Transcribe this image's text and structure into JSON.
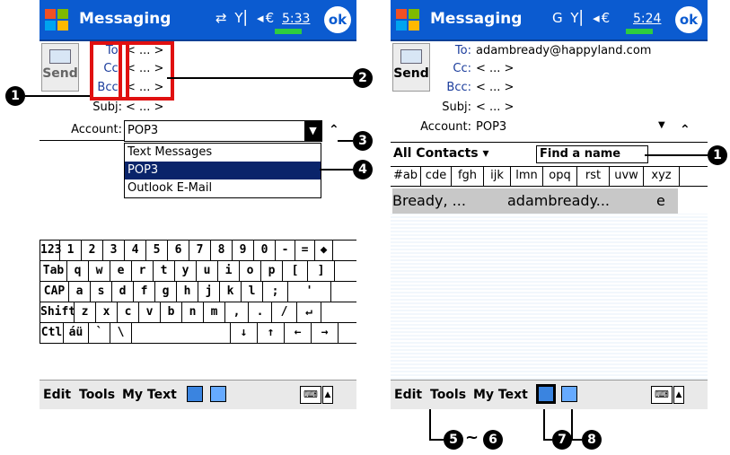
{
  "left_screen": {
    "title": "Messaging",
    "signal_icons": "⇄ Y▏◂€",
    "time": "5:33",
    "ok_label": "ok",
    "send_label": "Send",
    "header_labels": [
      "To:",
      "Cc:",
      "Bcc:",
      "Subj:"
    ],
    "header_values": [
      "< ... >",
      "< ... >",
      "< ... >",
      "< ... >"
    ],
    "account_label": "Account:",
    "account_value": "POP3",
    "account_options": [
      "Text Messages",
      "POP3",
      "Outlook E-Mail"
    ],
    "selected_option": "POP3",
    "keyboard_rows": [
      [
        "123",
        "1",
        "2",
        "3",
        "4",
        "5",
        "6",
        "7",
        "8",
        "9",
        "0",
        "-",
        "=",
        "◆"
      ],
      [
        "Tab",
        "q",
        "w",
        "e",
        "r",
        "t",
        "y",
        "u",
        "i",
        "o",
        "p",
        "[",
        "]"
      ],
      [
        "CAP",
        "a",
        "s",
        "d",
        "f",
        "g",
        "h",
        "j",
        "k",
        "l",
        ";",
        "'"
      ],
      [
        "Shift",
        "z",
        "x",
        "c",
        "v",
        "b",
        "n",
        "m",
        ",",
        ".",
        "/",
        "↵"
      ],
      [
        "Ctl",
        "áü",
        "`",
        "\\",
        "",
        "↓",
        "↑",
        "←",
        "→"
      ]
    ],
    "menu": [
      "Edit",
      "Tools",
      "My Text"
    ]
  },
  "right_screen": {
    "title": "Messaging",
    "signal_icons": "G Y▏◂€",
    "time": "5:24",
    "ok_label": "ok",
    "send_label": "Send",
    "header_labels": [
      "To:",
      "Cc:",
      "Bcc:",
      "Subj:",
      "Account:"
    ],
    "header_values": [
      "adambready@happyland.com",
      "< ... >",
      "< ... >",
      "< ... >",
      "POP3"
    ],
    "contacts_filter": "All Contacts",
    "find_placeholder": "Find a name",
    "abc_tabs": [
      "#ab",
      "cde",
      "fgh",
      "ijk",
      "lmn",
      "opq",
      "rst",
      "uvw",
      "xyz"
    ],
    "contact_name": "Bready, ...",
    "contact_email": "adambready...",
    "contact_type": "e",
    "menu": [
      "Edit",
      "Tools",
      "My Text"
    ]
  },
  "callouts": {
    "c1": "1",
    "c2": "2",
    "c3": "3",
    "c4": "4",
    "c5": "5",
    "c6": "6",
    "c7": "7",
    "c8": "8",
    "tilde": "~"
  },
  "colors": {
    "titlebar": "#0b5bd0",
    "highlight_box": "#e01010",
    "selection": "#0a246a"
  }
}
